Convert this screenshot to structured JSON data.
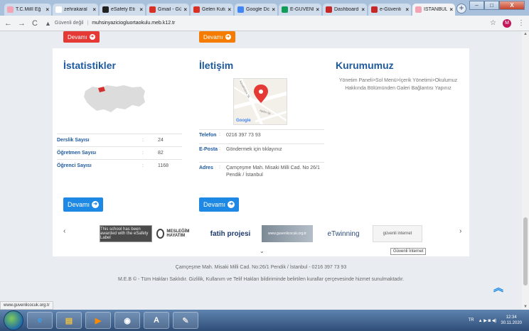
{
  "browser": {
    "tabs": [
      {
        "label": "T.C.Millî Eğ",
        "fav_color": "#f4a3b5"
      },
      {
        "label": "zehrakaral",
        "fav_color": "#ffffff"
      },
      {
        "label": "eSafety Eti",
        "fav_color": "#222222"
      },
      {
        "label": "Gmail - Gü",
        "fav_color": "#d93025"
      },
      {
        "label": "Gelen Kutu",
        "fav_color": "#d93025"
      },
      {
        "label": "Google Dc",
        "fav_color": "#4285f4"
      },
      {
        "label": "E-GÜVENL",
        "fav_color": "#0f9d58"
      },
      {
        "label": "Dashboard",
        "fav_color": "#c62828"
      },
      {
        "label": "e-Güvenli",
        "fav_color": "#c62828"
      },
      {
        "label": "İSTANBUL",
        "fav_color": "#f4a3b5",
        "active": true
      }
    ],
    "new_tab_glyph": "+",
    "window_buttons": {
      "minimize": "–",
      "maximize": "□",
      "close": "X"
    },
    "nav": {
      "back": "←",
      "forward": "→",
      "reload": "C"
    },
    "address": {
      "warning_icon": "▲",
      "security_label": "Güvenli değil",
      "separator": "|",
      "url": "muhsinyaziciogluortaokulu.meb.k12.tr"
    },
    "star_glyph": "☆",
    "profile_initial": "M",
    "menu_glyph": "⋮",
    "status_url": "www.guvenlicocuk.org.tr"
  },
  "page": {
    "top_buttons": [
      {
        "label": "Devamı",
        "arrow": "➜"
      },
      {
        "label": "Devamı",
        "arrow": "➜"
      }
    ],
    "statistics": {
      "title": "İstatistikler",
      "rows": [
        {
          "label": "Derslik Sayısı",
          "colon": ":",
          "value": "24"
        },
        {
          "label": "Öğretmen Sayısı",
          "colon": ":",
          "value": "82"
        },
        {
          "label": "Öğrenci Sayısı",
          "colon": ":",
          "value": "1168"
        }
      ],
      "button": "Devamı"
    },
    "contact": {
      "title": "İletişim",
      "map_brand": "Google",
      "map_street_1": "Kavaklıdere Sk",
      "map_street_2": "Aydın Sk",
      "rows": [
        {
          "label": "Telefon",
          "colon": ":",
          "value": "0216 397 73 93"
        },
        {
          "label": "E-Posta",
          "colon": ":",
          "value": "Göndermek için tıklayınız"
        },
        {
          "label": "Adres",
          "colon": ":",
          "value": "Çamçeşme Mah. Misaki Milli Cad. No 26/1 Pendik / İstanbul"
        }
      ],
      "button": "Devamı"
    },
    "about": {
      "title": "Kurumumuz",
      "text": "Yönetim Paneli>Sol Menü>İçerik Yönetimi>Okulumuz Hakkında Bölümünden Galeri Bağlantısı Yapınız"
    },
    "partners": {
      "prev": "‹",
      "next": "›",
      "logos": [
        {
          "name": "eSafety Label",
          "text": "This school has been awarded with the eSafety Label"
        },
        {
          "name": "Mesleğim Hayatım",
          "text": "MESLEĞİM HAYATIM"
        },
        {
          "name": "Fatih Projesi",
          "text": "fatih projesi"
        },
        {
          "name": "Banner",
          "text": "www.guvenlicocuk.org.tr"
        },
        {
          "name": "eTwinning",
          "text": "eTwinning"
        },
        {
          "name": "Güvenli İnternet",
          "text": "güvenli internet"
        }
      ],
      "tooltip": "Güvenli İnternet",
      "collapse_glyph": "⌄"
    },
    "footer": {
      "address": "Çamçeşme Mah. Misaki Milli Cad. No:26/1 Pendik / İstanbul - 0216 397 73 93",
      "copyright": "M.E.B © - Tüm Hakları Saklıdır. Gizlilik, Kullanım ve Telif Hakları bildiriminde belirtilen kurallar çerçevesinde hizmet sunulmaktadır.",
      "to_top_glyph": "︽"
    }
  },
  "taskbar": {
    "apps": [
      {
        "name": "Internet Explorer",
        "glyph": "e",
        "color": "#3aa0e8"
      },
      {
        "name": "File Explorer",
        "glyph": "▤",
        "color": "#f0c040"
      },
      {
        "name": "Media Player",
        "glyph": "▶",
        "color": "#ff8a00"
      },
      {
        "name": "Chrome",
        "glyph": "◉",
        "color": "#ffffff"
      },
      {
        "name": "Acrobat",
        "glyph": "A",
        "color": "#ffffff"
      },
      {
        "name": "Tool",
        "glyph": "✎",
        "color": "#dddddd"
      }
    ],
    "language": "TR",
    "tray_icons": "▲ ▶ ◙ ◀)",
    "time": "12:34",
    "date": "30.11.2020"
  },
  "colors": {
    "accent_blue": "#1e88e5",
    "heading_blue": "#1e5aa0",
    "button_red": "#e53935",
    "button_orange": "#f57c00"
  }
}
